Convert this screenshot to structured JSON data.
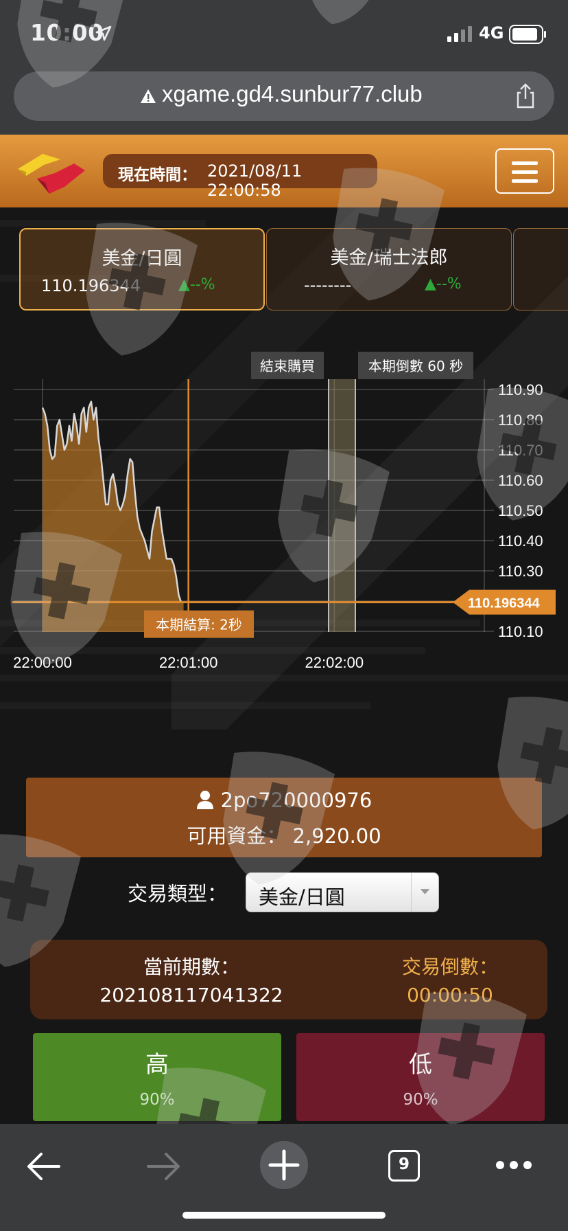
{
  "status_bar": {
    "time": "10:00",
    "network": "4G"
  },
  "browser": {
    "url": "xgame.gd4.sunbur77.club",
    "tab_count": "9"
  },
  "header": {
    "time_label": "現在時間：",
    "time_value": "2021/08/11 22:00:58"
  },
  "currency_cards": [
    {
      "name": "美金/日圓",
      "value": "110.196344",
      "change": "▲--%",
      "active": true
    },
    {
      "name": "美金/瑞士法郎",
      "value": "--------",
      "change": "▲--%",
      "active": false
    }
  ],
  "chart_data": {
    "type": "area",
    "y_ticks": [
      "110.90",
      "110.80",
      "110.70",
      "110.60",
      "110.50",
      "110.40",
      "110.30",
      "110.20",
      "110.10"
    ],
    "x_ticks": [
      "22:00:00",
      "22:01:00",
      "22:02:00"
    ],
    "ylim": [
      110.1,
      110.9
    ],
    "x_range_seconds": [
      0,
      180
    ],
    "x": [
      0,
      1,
      2,
      3,
      4,
      5,
      6,
      7,
      8,
      9,
      10,
      11,
      12,
      13,
      14,
      15,
      16,
      17,
      18,
      19,
      20,
      21,
      22,
      23,
      24,
      25,
      26,
      27,
      28,
      29,
      30,
      31,
      32,
      33,
      34,
      35,
      36,
      37,
      38,
      39,
      40,
      41,
      42,
      43,
      44,
      45,
      46,
      47,
      48,
      49,
      50,
      51,
      52,
      53,
      54,
      55,
      56,
      57,
      58
    ],
    "values": [
      110.84,
      110.82,
      110.78,
      110.7,
      110.67,
      110.68,
      110.78,
      110.8,
      110.75,
      110.7,
      110.72,
      110.78,
      110.73,
      110.82,
      110.78,
      110.72,
      110.82,
      110.84,
      110.76,
      110.84,
      110.86,
      110.8,
      110.84,
      110.74,
      110.68,
      110.6,
      110.52,
      110.52,
      110.6,
      110.62,
      110.58,
      110.52,
      110.5,
      110.52,
      110.55,
      110.62,
      110.67,
      110.66,
      110.56,
      110.48,
      110.44,
      110.42,
      110.4,
      110.37,
      110.34,
      110.43,
      110.47,
      110.51,
      110.51,
      110.44,
      110.39,
      110.34,
      110.34,
      110.34,
      110.32,
      110.28,
      110.22,
      110.196,
      110.196
    ],
    "current_price_label": "110.196344",
    "settle_label": "本期結算: 2秒",
    "end_purchase_label": "結束購買",
    "countdown_label": "本期倒數 60 秒"
  },
  "account": {
    "username": "2po720000976",
    "funds_label": "可用資金：",
    "funds_value": "2,920.00"
  },
  "trade_type": {
    "label": "交易類型：",
    "selected": "美金/日圓"
  },
  "period": {
    "current_label": "當前期數：",
    "current_value": "202108117041322",
    "countdown_label": "交易倒數：",
    "countdown_value": "00:00:50"
  },
  "buttons": {
    "high_label": "高",
    "high_payout": "90%",
    "low_label": "低",
    "low_payout": "90%"
  },
  "colors": {
    "accent_orange": "#e59a3f",
    "high_green": "#4d8a26",
    "low_red": "#6e1a2b",
    "price_line": "#e08a2c"
  }
}
